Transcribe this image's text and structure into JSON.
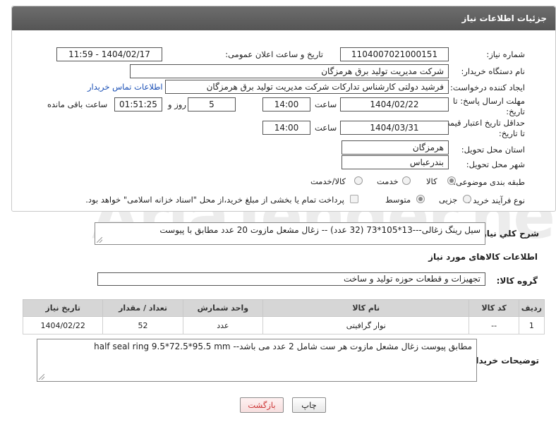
{
  "header": {
    "title": "جزئیات اطلاعات نیاز"
  },
  "form": {
    "need_number_label": "شماره نیاز:",
    "need_number": "1104007021000151",
    "announce_label": "تاریخ و ساعت اعلان عمومی:",
    "announce_value": "1404/02/17 - 11:59",
    "buyer_org_label": "نام دستگاه خریدار:",
    "buyer_org": "شرکت مدیریت تولید برق هرمزگان",
    "creator_label": "ایجاد کننده درخواست:",
    "creator": "فرشید دولتی کارشناس تدارکات شرکت مدیریت تولید برق هرمزگان",
    "contact_link": "اطلاعات تماس خریدار",
    "deadline_label_1": "مهلت ارسال پاسخ: تا",
    "deadline_label_2": "تاریخ:",
    "deadline_date": "1404/02/22",
    "time_label": "ساعت",
    "deadline_time": "14:00",
    "days_value": "5",
    "days_label": "روز و",
    "remaining_time": "01:51:25",
    "remaining_label": "ساعت باقی مانده",
    "price_label_1": "حداقل تاریخ اعتبار قیمت:",
    "price_label_2": "تا تاریخ:",
    "price_date": "1404/03/31",
    "price_time": "14:00",
    "province_label": "استان محل تحویل:",
    "province": "هرمزگان",
    "city_label": "شهر محل تحویل:",
    "city": "بندرعباس",
    "category_label": "طبقه بندی موضوعی:",
    "category_options": [
      "کالا",
      "خدمت",
      "کالا/خدمت"
    ],
    "process_label": "نوع فرآیند خرید :",
    "process_options": [
      "جزیی",
      "متوسط"
    ],
    "payment_note": "پرداخت تمام یا بخشی از مبلغ خرید،از محل \"اسناد خزانه اسلامی\" خواهد بود."
  },
  "description": {
    "label": "شرح کلي نياز:",
    "value": "سیل رینگ زغالی---13*105*73 (32 عدد) -- زغال مشعل مازوت 20 عدد مطابق با پیوست"
  },
  "goods": {
    "section_title": "اطلاعات کالاهای مورد نیاز",
    "group_label": "گروه کالا:",
    "group_value": "تجهیزات و قطعات حوزه تولید و ساخت",
    "columns": [
      "ردیف",
      "کد کالا",
      "نام کالا",
      "واحد شمارش",
      "تعداد / مقدار",
      "تاریخ نیاز"
    ],
    "rows": [
      {
        "row": "1",
        "code": "--",
        "name": "نوار گرافیتی",
        "unit": "عدد",
        "qty": "52",
        "date": "1404/02/22"
      }
    ]
  },
  "buyer_notes": {
    "label": "توضیحات خریدار:",
    "value": "مطابق پیوست   زغال مشعل مازوت هر ست شامل 2 عدد می باشد-- half seal ring 9.5*72.5*95.5 mm"
  },
  "buttons": {
    "print": "چاپ",
    "back": "بازگشت"
  },
  "watermark": "AriaTender.neT"
}
